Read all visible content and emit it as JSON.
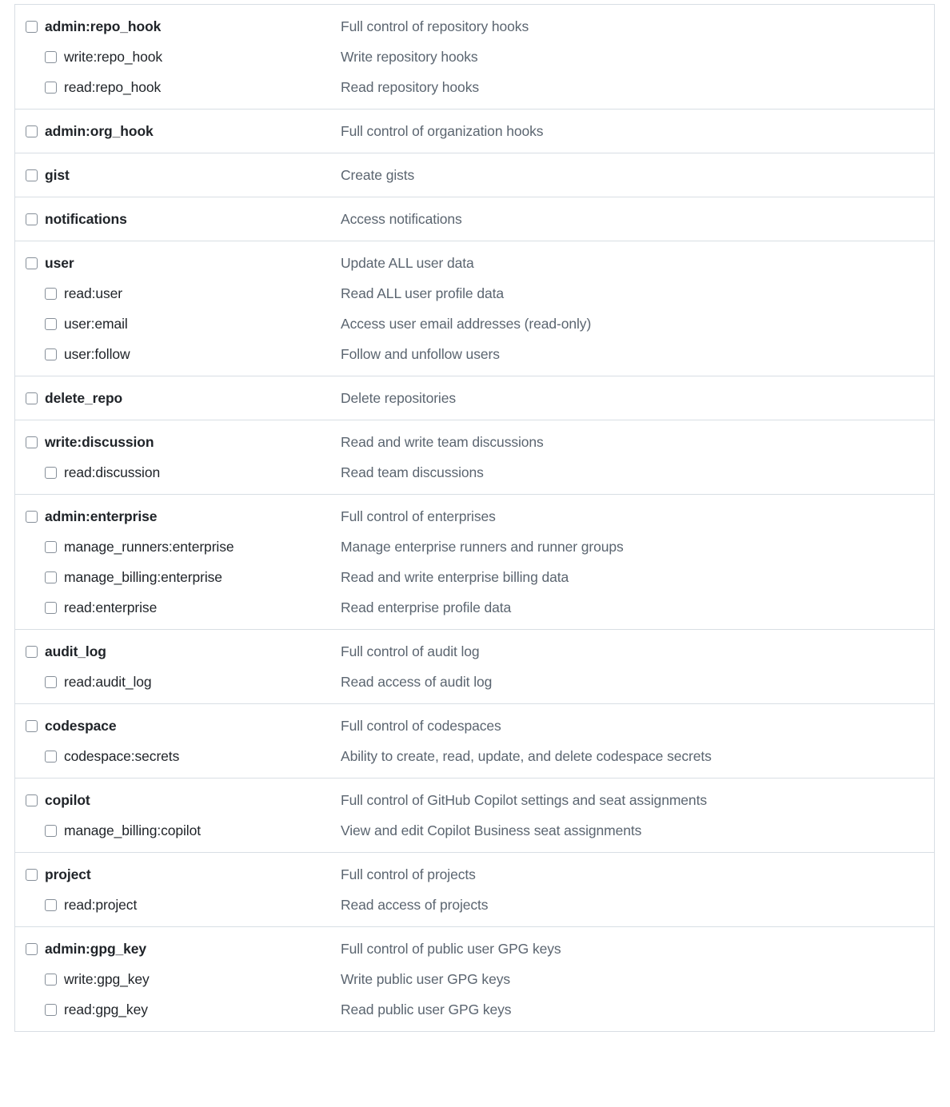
{
  "colors": {
    "border": "#d8dee4",
    "scope_name": "#1f2328",
    "scope_desc": "#5b6570",
    "checkbox_border": "#868f99",
    "background": "#ffffff"
  },
  "scope_groups": [
    {
      "rows": [
        {
          "level": "parent",
          "name": "admin:repo_hook",
          "description": "Full control of repository hooks",
          "checked": false
        },
        {
          "level": "child",
          "name": "write:repo_hook",
          "description": "Write repository hooks",
          "checked": false
        },
        {
          "level": "child",
          "name": "read:repo_hook",
          "description": "Read repository hooks",
          "checked": false
        }
      ]
    },
    {
      "rows": [
        {
          "level": "parent",
          "name": "admin:org_hook",
          "description": "Full control of organization hooks",
          "checked": false
        }
      ]
    },
    {
      "rows": [
        {
          "level": "parent",
          "name": "gist",
          "description": "Create gists",
          "checked": false
        }
      ]
    },
    {
      "rows": [
        {
          "level": "parent",
          "name": "notifications",
          "description": "Access notifications",
          "checked": false
        }
      ]
    },
    {
      "rows": [
        {
          "level": "parent",
          "name": "user",
          "description": "Update ALL user data",
          "checked": false
        },
        {
          "level": "child",
          "name": "read:user",
          "description": "Read ALL user profile data",
          "checked": false
        },
        {
          "level": "child",
          "name": "user:email",
          "description": "Access user email addresses (read-only)",
          "checked": false
        },
        {
          "level": "child",
          "name": "user:follow",
          "description": "Follow and unfollow users",
          "checked": false
        }
      ]
    },
    {
      "rows": [
        {
          "level": "parent",
          "name": "delete_repo",
          "description": "Delete repositories",
          "checked": false
        }
      ]
    },
    {
      "rows": [
        {
          "level": "parent",
          "name": "write:discussion",
          "description": "Read and write team discussions",
          "checked": false
        },
        {
          "level": "child",
          "name": "read:discussion",
          "description": "Read team discussions",
          "checked": false
        }
      ]
    },
    {
      "rows": [
        {
          "level": "parent",
          "name": "admin:enterprise",
          "description": "Full control of enterprises",
          "checked": false
        },
        {
          "level": "child",
          "name": "manage_runners:enterprise",
          "description": "Manage enterprise runners and runner groups",
          "checked": false
        },
        {
          "level": "child",
          "name": "manage_billing:enterprise",
          "description": "Read and write enterprise billing data",
          "checked": false
        },
        {
          "level": "child",
          "name": "read:enterprise",
          "description": "Read enterprise profile data",
          "checked": false
        }
      ]
    },
    {
      "rows": [
        {
          "level": "parent",
          "name": "audit_log",
          "description": "Full control of audit log",
          "checked": false
        },
        {
          "level": "child",
          "name": "read:audit_log",
          "description": "Read access of audit log",
          "checked": false
        }
      ]
    },
    {
      "rows": [
        {
          "level": "parent",
          "name": "codespace",
          "description": "Full control of codespaces",
          "checked": false
        },
        {
          "level": "child",
          "name": "codespace:secrets",
          "description": "Ability to create, read, update, and delete codespace secrets",
          "checked": false
        }
      ]
    },
    {
      "rows": [
        {
          "level": "parent",
          "name": "copilot",
          "description": "Full control of GitHub Copilot settings and seat assignments",
          "checked": false
        },
        {
          "level": "child",
          "name": "manage_billing:copilot",
          "description": "View and edit Copilot Business seat assignments",
          "checked": false
        }
      ]
    },
    {
      "rows": [
        {
          "level": "parent",
          "name": "project",
          "description": "Full control of projects",
          "checked": false
        },
        {
          "level": "child",
          "name": "read:project",
          "description": "Read access of projects",
          "checked": false
        }
      ]
    },
    {
      "rows": [
        {
          "level": "parent",
          "name": "admin:gpg_key",
          "description": "Full control of public user GPG keys",
          "checked": false
        },
        {
          "level": "child",
          "name": "write:gpg_key",
          "description": "Write public user GPG keys",
          "checked": false
        },
        {
          "level": "child",
          "name": "read:gpg_key",
          "description": "Read public user GPG keys",
          "checked": false
        }
      ]
    }
  ]
}
